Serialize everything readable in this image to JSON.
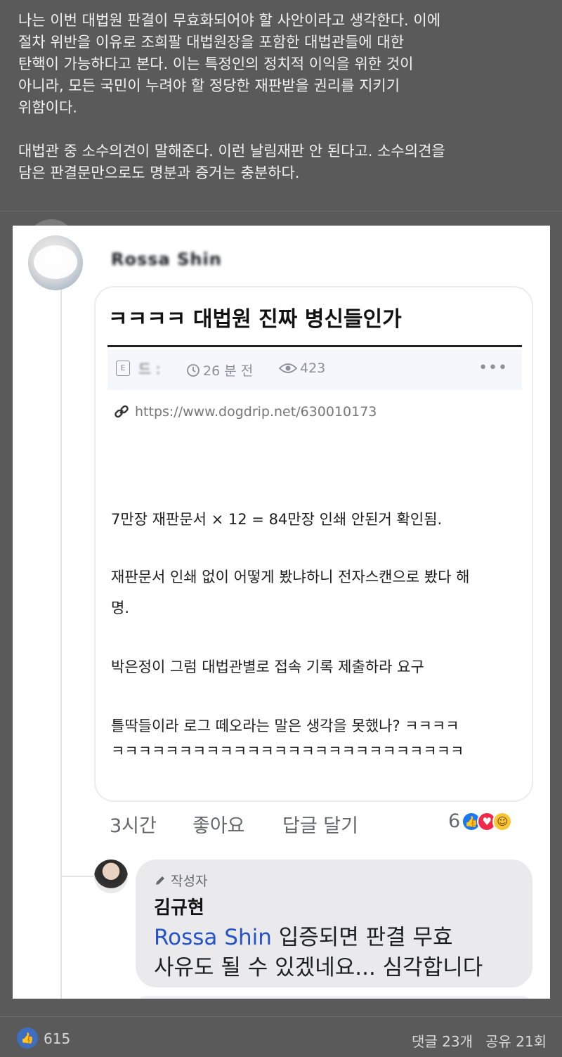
{
  "post": {
    "paragraph1": "나는 이번 대법원 판결이 무효화되어야 할 사안이라고 생각한다. 이에\n절차 위반을 이유로 조희팔 대법원장을 포함한 대법관들에 대한\n탄핵이 가능하다고 본다. 이는 특정인의 정치적 이익을 위한 것이\n아니라, 모든 국민이 누려야 할 정당한 재판받을 권리를 지키기\n위함이다.",
    "paragraph2": "대법관 중 소수의견이 말해준다. 이런 날림재판 안 된다고. 소수의견을\n담은 판결문만으로도 명분과 증거는 충분하다."
  },
  "comment": {
    "author_name": "Rossa Shin",
    "card": {
      "title": "ㅋㅋㅋㅋ 대법원 진짜 병신들인가",
      "meta_author": "드 :",
      "time_ago": "26 분 전",
      "views": "423",
      "more": "•••",
      "url": "https://www.dogdrip.net/630010173",
      "lines": [
        "7만장 재판문서 × 12 = 84만장 인쇄 안된거 확인됨.",
        "재판문서 인쇄 없이 어떻게 봤냐하니 전자스캔으로 봤다 해",
        "명.",
        "박은정이 그럼 대법관별로 접속 기록 제출하라 요구",
        "틀딱들이라 로그 떼오라는 말은 생각을 못했나? ㅋㅋㅋㅋ",
        "ㅋㅋㅋㅋㅋㅋㅋㅋㅋㅋㅋㅋㅋㅋㅋㅋㅋㅋㅋㅋㅋㅋㅋㅋㅋㅋ"
      ]
    },
    "time": "3시간",
    "like_label": "좋아요",
    "reply_label": "답글 달기",
    "reaction_count": "6"
  },
  "reply": {
    "badge": "작성자",
    "name": "김규현",
    "mention": "Rossa Shin",
    "text_after_mention": " 입증되면 판결 무효\n사유도 될 수 있겠네요... 심각합니다"
  },
  "footer": {
    "like_count": "615",
    "comments": "댓글 23개",
    "shares": "공유 21회"
  },
  "colors": {
    "background": "#5a5a5a",
    "mention": "#2553c6",
    "like_blue": "#1877f2",
    "love_red": "#f0284a"
  }
}
